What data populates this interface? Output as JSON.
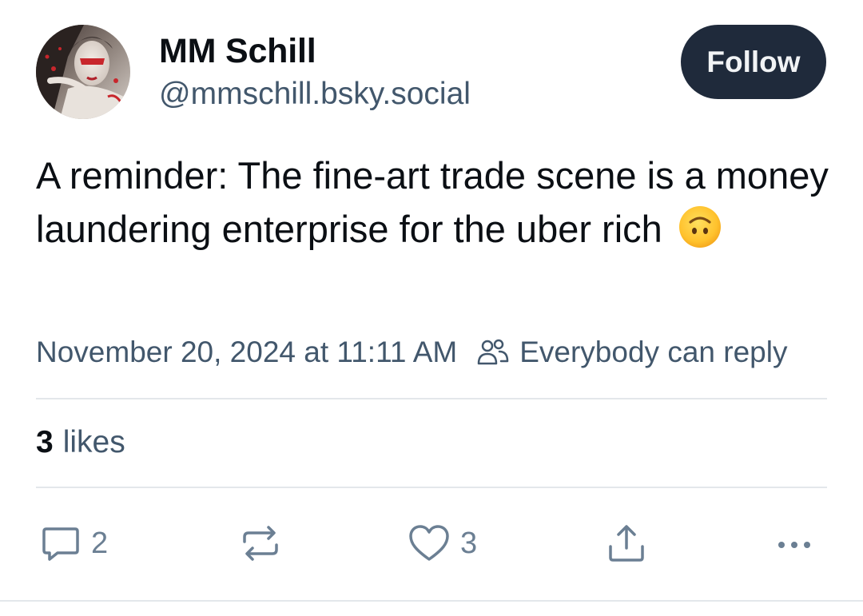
{
  "author": {
    "name": "MM Schill",
    "handle": "@mmschill.bsky.social"
  },
  "follow_label": "Follow",
  "post": {
    "text": "A reminder: The fine-art trade scene is a money laundering enterprise for the uber rich",
    "emoji": "upside-down-face-emoji"
  },
  "meta": {
    "timestamp": "November 20, 2024 at 11:11 AM",
    "reply_setting": "Everybody can reply",
    "reply_icon": "people-icon"
  },
  "likes": {
    "count": "3",
    "label": "likes"
  },
  "actions": {
    "reply": {
      "icon": "reply-icon",
      "count": "2"
    },
    "repost": {
      "icon": "repost-icon"
    },
    "like": {
      "icon": "heart-icon",
      "count": "3"
    },
    "share": {
      "icon": "share-icon"
    },
    "more": {
      "icon": "more-icon"
    }
  },
  "colors": {
    "follow_bg": "#1f2a3b",
    "secondary_text": "#42576c",
    "icon_gray": "#6b7f93",
    "divider": "#e3e7eb"
  }
}
